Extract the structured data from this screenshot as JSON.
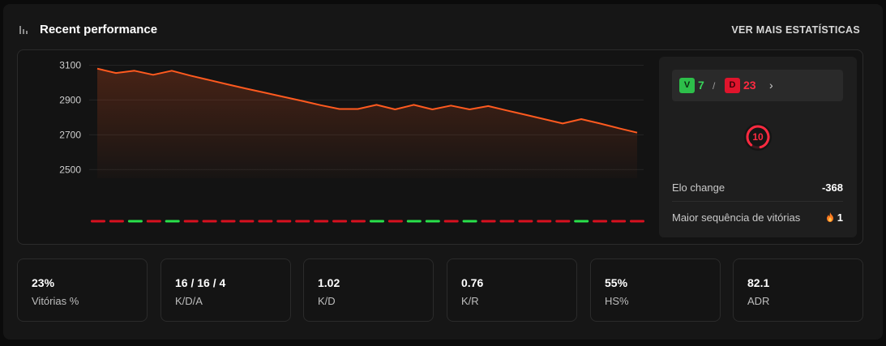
{
  "header": {
    "title": "Recent performance",
    "more_link": "VER MAIS ESTATÍSTICAS"
  },
  "colors": {
    "accent": "#ff5a1f",
    "win": "#2dbf4a",
    "loss": "#e0142c",
    "background": "#161616"
  },
  "chart_data": {
    "type": "area",
    "ylim": [
      2450,
      3130
    ],
    "yticks": [
      3100,
      2900,
      2700,
      2500
    ],
    "tick_labels": [
      "3100",
      "2900",
      "2700",
      "2500"
    ],
    "x": [
      1,
      2,
      3,
      4,
      5,
      6,
      7,
      8,
      9,
      10,
      11,
      12,
      13,
      14,
      15,
      16,
      17,
      18,
      19,
      20,
      21,
      22,
      23,
      24,
      25,
      26,
      27,
      28,
      29,
      30
    ],
    "values": [
      3080,
      3055,
      3068,
      3045,
      3068,
      3040,
      3015,
      2990,
      2965,
      2942,
      2918,
      2895,
      2870,
      2848,
      2848,
      2872,
      2846,
      2872,
      2846,
      2868,
      2846,
      2865,
      2840,
      2815,
      2790,
      2765,
      2790,
      2765,
      2738,
      2712
    ],
    "results": [
      "L",
      "L",
      "W",
      "L",
      "W",
      "L",
      "L",
      "L",
      "L",
      "L",
      "L",
      "L",
      "L",
      "L",
      "L",
      "W",
      "L",
      "W",
      "W",
      "L",
      "W",
      "L",
      "L",
      "L",
      "L",
      "L",
      "W",
      "L",
      "L",
      "L"
    ],
    "grid": true,
    "area_fill": true
  },
  "summary": {
    "wins_badge": "V",
    "wins": "7",
    "separator": "/",
    "losses_badge": "D",
    "losses": "23",
    "chevron": "›",
    "level": "10",
    "level_progress": 0.85,
    "elo_change_label": "Elo change",
    "elo_change_value": "-368",
    "win_streak_label": "Maior sequência de vitórias",
    "win_streak_value": "1",
    "streak_icon": "fire-icon"
  },
  "stats": [
    {
      "value": "23%",
      "label": "Vitórias %"
    },
    {
      "value": "16 / 16 / 4",
      "label": "K/D/A"
    },
    {
      "value": "1.02",
      "label": "K/D"
    },
    {
      "value": "0.76",
      "label": "K/R"
    },
    {
      "value": "55%",
      "label": "HS%"
    },
    {
      "value": "82.1",
      "label": "ADR"
    }
  ]
}
